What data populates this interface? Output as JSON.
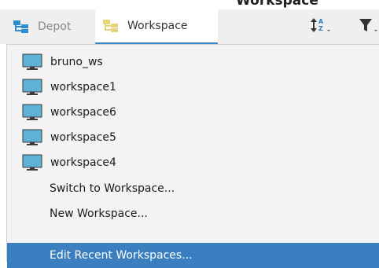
{
  "window": {
    "title_fragment": "Workspace"
  },
  "tabs": [
    {
      "label": "Depot",
      "icon": "tree-icon"
    },
    {
      "label": "Workspace",
      "icon": "tree-icon",
      "active": true
    }
  ],
  "toolbar": {
    "sort_icon": "sort-az-icon",
    "filter_icon": "filter-icon"
  },
  "dropdown": {
    "workspaces": [
      {
        "name": "bruno_ws",
        "icon": "monitor-icon"
      },
      {
        "name": "workspace1",
        "icon": "monitor-icon"
      },
      {
        "name": "workspace6",
        "icon": "monitor-icon"
      },
      {
        "name": "workspace5",
        "icon": "monitor-icon"
      },
      {
        "name": "workspace4",
        "icon": "monitor-icon"
      }
    ],
    "commands": [
      {
        "label": "Switch to Workspace..."
      },
      {
        "label": "New Workspace..."
      },
      {
        "label": "Edit Recent Workspaces...",
        "highlighted": true
      }
    ]
  },
  "colors": {
    "accent": "#3e86c6",
    "highlight": "#3b7fc0",
    "monitor": "#5fb2d6",
    "tree_icon": "#2f8fce",
    "tree_icon_alt": "#e7d37a"
  }
}
